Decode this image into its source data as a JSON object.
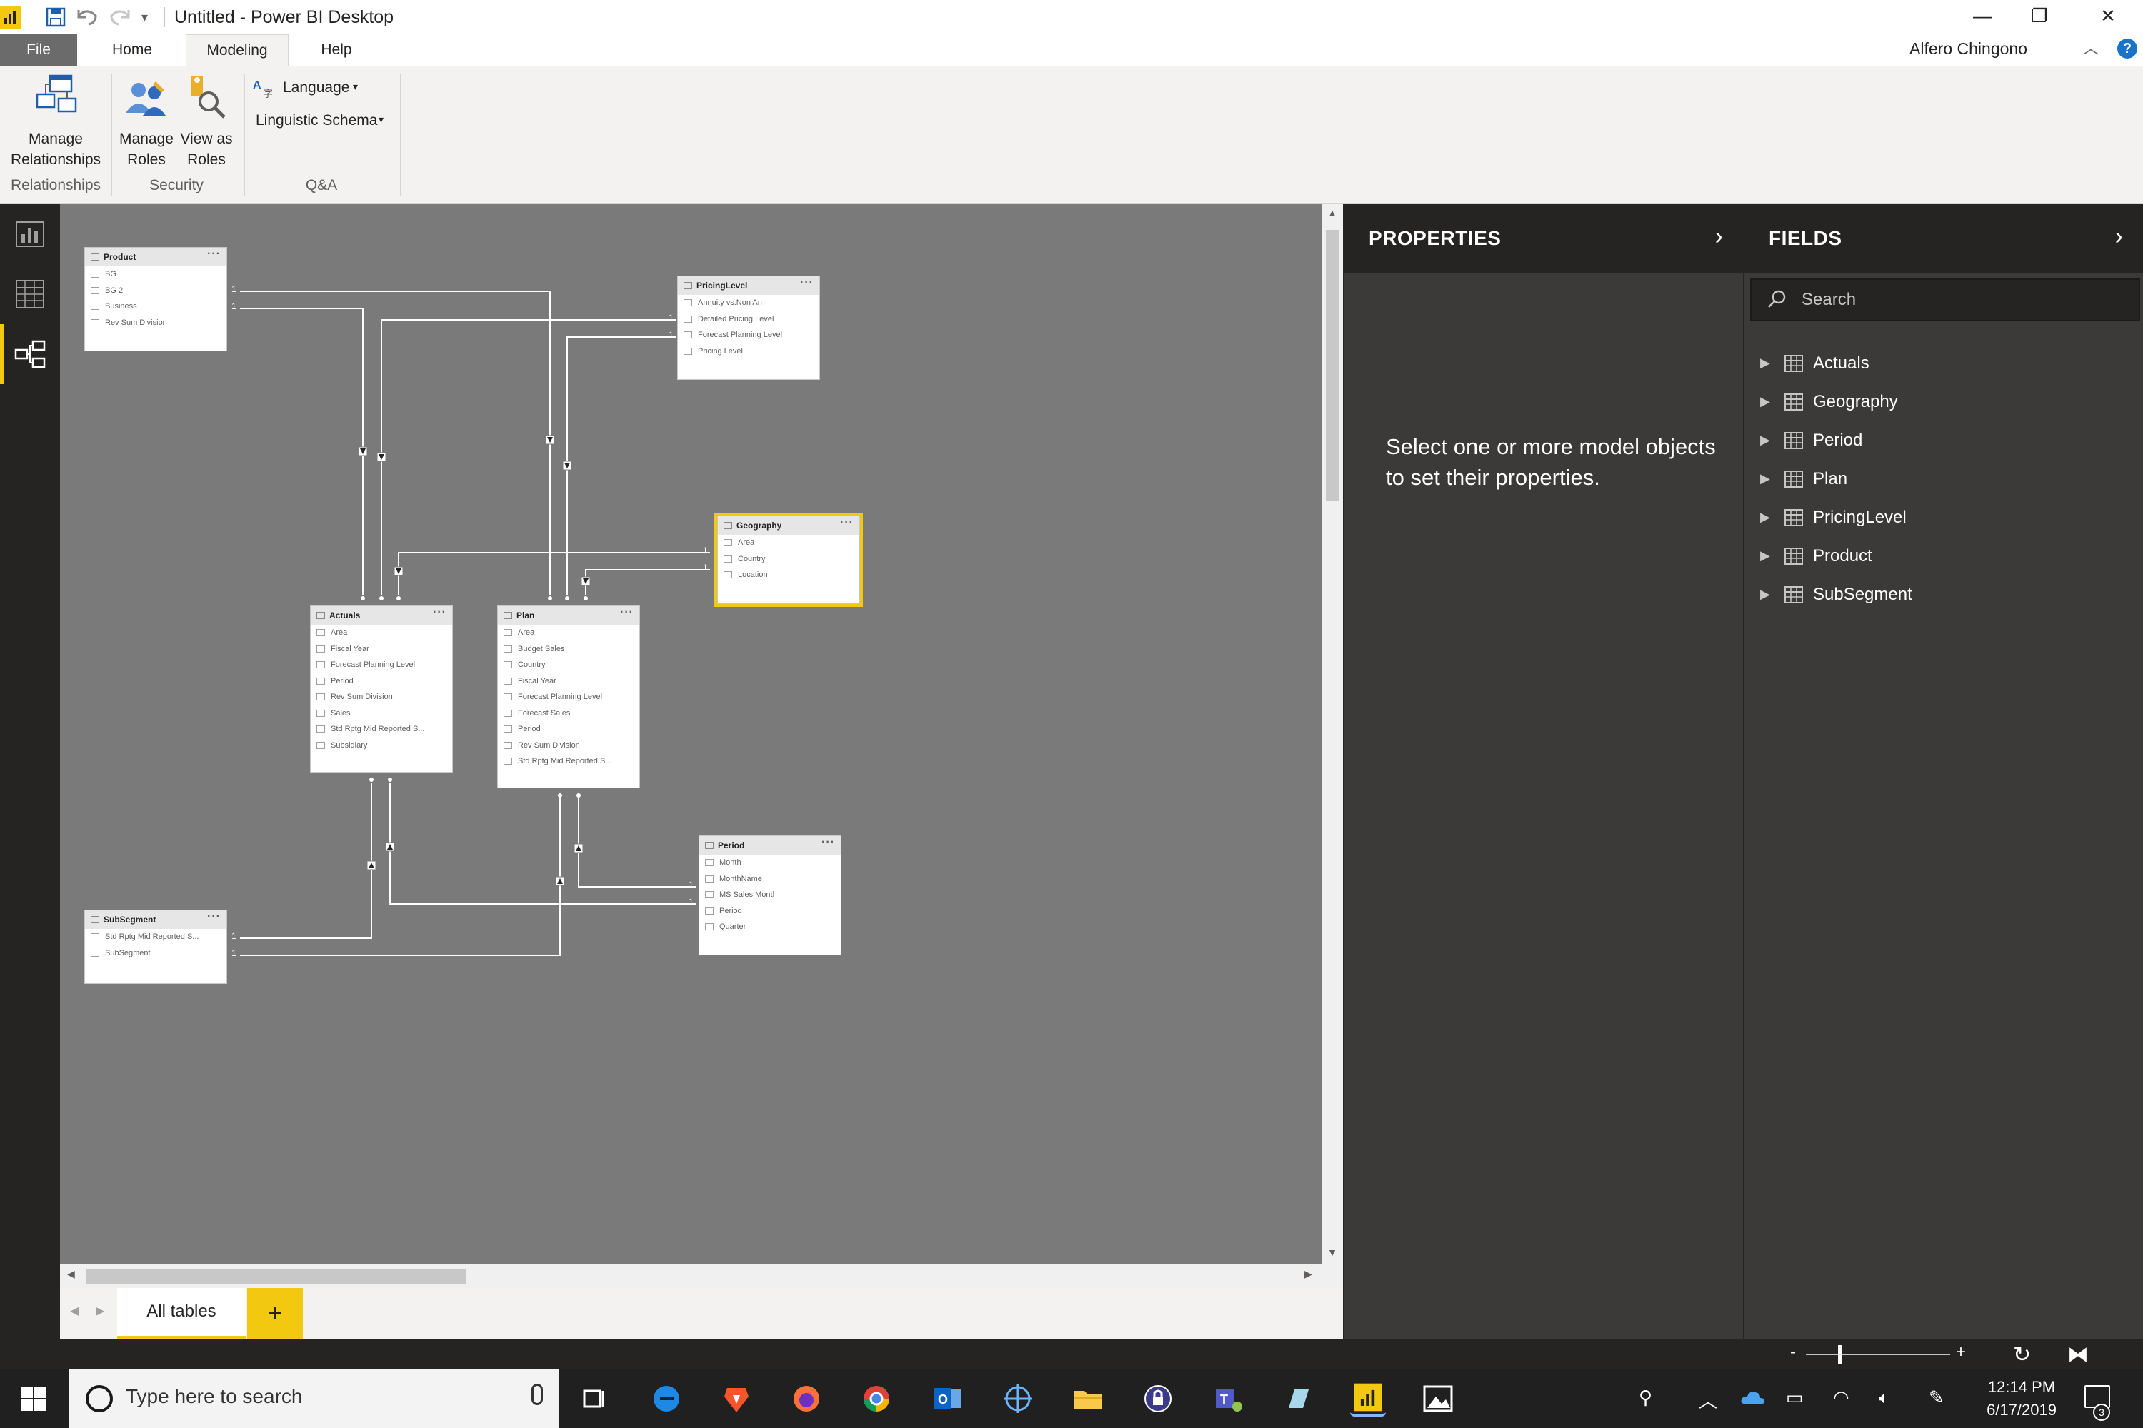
{
  "titlebar": {
    "title": "Untitled - Power BI Desktop",
    "qat_dropdown": "▾",
    "minimize": "—",
    "restore": "❐",
    "close": "✕"
  },
  "ribbon_tabs": {
    "file": "File",
    "home": "Home",
    "modeling": "Modeling",
    "help": "Help",
    "user": "Alfero Chingono",
    "collapse": "︿",
    "help_icon": "?"
  },
  "ribbon": {
    "manage_relationships": [
      "Manage",
      "Relationships"
    ],
    "manage_roles": [
      "Manage",
      "Roles"
    ],
    "view_as_roles": [
      "View as",
      "Roles"
    ],
    "language": "Language",
    "linguistic_schema": "Linguistic Schema",
    "groups": {
      "relationships": "Relationships",
      "security": "Security",
      "qa": "Q&A"
    }
  },
  "model_tables": {
    "product": {
      "name": "Product",
      "fields": [
        "BG",
        "BG 2",
        "Business",
        "Rev Sum Division"
      ]
    },
    "pricinglevel": {
      "name": "PricingLevel",
      "fields": [
        "Annuity vs.Non An",
        "Detailed Pricing Level",
        "Forecast Planning Level",
        "Pricing Level"
      ]
    },
    "geography": {
      "name": "Geography",
      "fields": [
        "Area",
        "Country",
        "Location"
      ]
    },
    "actuals": {
      "name": "Actuals",
      "fields": [
        "Area",
        "Fiscal Year",
        "Forecast Planning Level",
        "Period",
        "Rev Sum Division",
        "Sales",
        "Std Rptg Mid Reported S...",
        "Subsidiary"
      ]
    },
    "plan": {
      "name": "Plan",
      "fields": [
        "Area",
        "Budget Sales",
        "Country",
        "Fiscal Year",
        "Forecast Planning Level",
        "Forecast Sales",
        "Period",
        "Rev Sum Division",
        "Std Rptg Mid Reported S..."
      ]
    },
    "period": {
      "name": "Period",
      "fields": [
        "Month",
        "MonthName",
        "MS Sales Month",
        "Period",
        "Quarter"
      ]
    },
    "subsegment": {
      "name": "SubSegment",
      "fields": [
        "Std Rptg Mid Reported S...",
        "SubSegment"
      ]
    },
    "more": "···",
    "cardinality_one": "1"
  },
  "page_tabs": {
    "nav_prev": "◀",
    "nav_next": "▶",
    "all_tables": "All tables",
    "add": "+"
  },
  "properties": {
    "title": "PROPERTIES",
    "collapse": "›",
    "empty_message": "Select one or more model objects to set their properties."
  },
  "fields_pane": {
    "title": "FIELDS",
    "collapse": "›",
    "search_placeholder": "Search",
    "expand_glyph": "▶",
    "tables": [
      "Actuals",
      "Geography",
      "Period",
      "Plan",
      "PricingLevel",
      "Product",
      "SubSegment"
    ]
  },
  "statusbar": {
    "zoom_minus": "-",
    "zoom_plus": "+",
    "zoom_level_fraction": 0.24
  },
  "taskbar": {
    "search_placeholder": "Type here to search",
    "time": "12:14 PM",
    "date": "6/17/2019",
    "notification_count": "3"
  }
}
